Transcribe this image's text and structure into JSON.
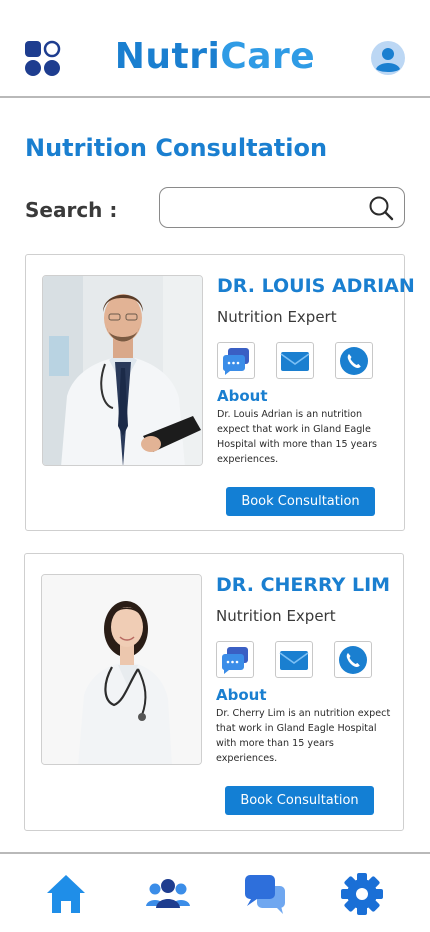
{
  "header": {
    "brand_part1": "Nutri",
    "brand_part2": "Care",
    "menu_icon": "grid-menu-icon",
    "avatar_icon": "user-avatar-icon"
  },
  "page": {
    "title": "Nutrition Consultation",
    "search_label": "Search :",
    "search_value": "",
    "search_placeholder": ""
  },
  "doctors": [
    {
      "name": "DR. LOUIS ADRIAN",
      "role": "Nutrition Expert",
      "about_title": "About",
      "about": "Dr. Louis Adrian is an nutrition expect that work in Gland Eagle Hospital with more than 15 years experiences.",
      "book_label": "Book Consultation"
    },
    {
      "name": "DR. CHERRY LIM",
      "role": "Nutrition Expert",
      "about_title": "About",
      "about": "Dr. Cherry Lim is an nutrition expect that work in Gland Eagle Hospital with more than 15 years experiences.",
      "book_label": "Book Consultation"
    }
  ],
  "bottom_nav": [
    "home-icon",
    "users-icon",
    "chat-icon",
    "settings-icon"
  ],
  "colors": {
    "primary": "#1a7fd0",
    "button": "#137fd4",
    "menu_dark": "#1e3d8f"
  }
}
